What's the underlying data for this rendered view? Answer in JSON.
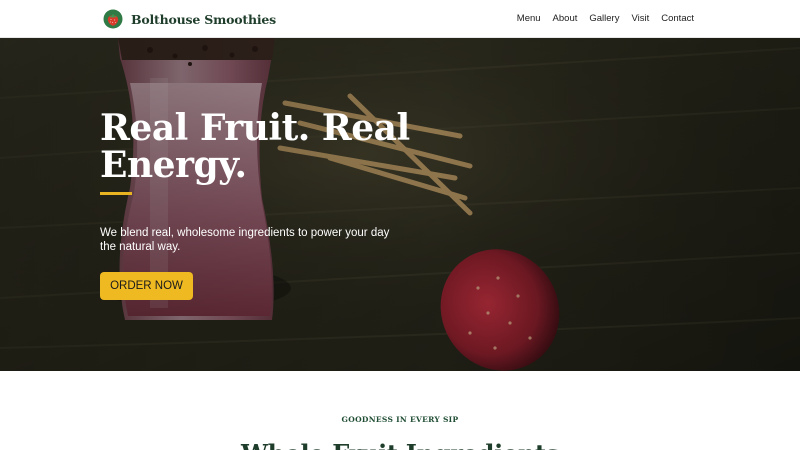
{
  "brand": {
    "name": "Bolthouse Smoothies",
    "logo_icon": "strawberry-logo-icon"
  },
  "nav": {
    "links": [
      {
        "label": "Menu"
      },
      {
        "label": "About"
      },
      {
        "label": "Gallery"
      },
      {
        "label": "Visit"
      },
      {
        "label": "Contact"
      }
    ]
  },
  "hero": {
    "title_lines": [
      "Real Fruit. Real",
      "Energy."
    ],
    "description_lines": [
      "We blend real, wholesome ingredients to power your day",
      "the natural way."
    ],
    "cta_label": "ORDER NOW",
    "background_image": "smoothie glass with strawberry on dark wooden table"
  },
  "section": {
    "eyebrow": "GOODNESS IN EVERY SIP",
    "title": "Whole Fruit Ingredients"
  },
  "colors": {
    "brand_green": "#1f3d2b",
    "accent_yellow": "#efb921",
    "rule_yellow": "#e8b422"
  }
}
